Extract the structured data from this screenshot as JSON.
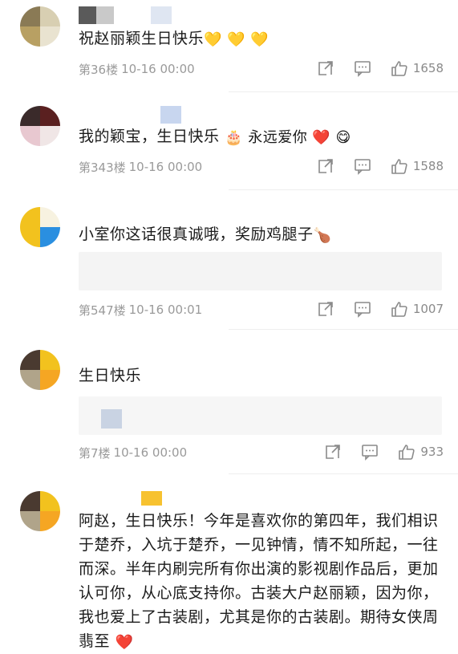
{
  "comments": [
    {
      "text": "祝赵丽颖生日快乐",
      "emoji": "💛 💛 💛",
      "floor": "第36楼",
      "time": "10-16 00:00",
      "likes": "1658"
    },
    {
      "text": "我的颖宝，生日快乐",
      "emoji": "🎂 永远爱你 ❤️ 😋",
      "floor": "第343楼",
      "time": "10-16 00:00",
      "likes": "1588"
    },
    {
      "text": "小室你这话很真诚哦，奖励鸡腿子",
      "emoji": "🍗",
      "floor": "第547楼",
      "time": "10-16 00:01",
      "likes": "1007"
    },
    {
      "text": "生日快乐",
      "emoji": "",
      "floor": "第7楼",
      "time": "10-16 00:00",
      "likes": "933"
    },
    {
      "text": "阿赵，生日快乐！今年是喜欢你的第四年，我们相识于楚乔，入坑于楚乔，一见钟情，情不知所起，一往而深。半年内刷完所有你出演的影视剧作品后，更加认可你，从心底支持你。古装大户赵丽颖，因为你，我也爱上了古装剧，尤其是你的古装剧。期待女侠周翡至",
      "emoji": "❤️",
      "floor": "",
      "time": "",
      "likes": ""
    }
  ],
  "icons": {
    "share": "share-icon",
    "reply": "comment-icon",
    "like": "thumbs-up-icon"
  },
  "colors": {
    "meta": "#9a9a9a",
    "text": "#1a1a1a",
    "heart": "#e0282e",
    "gold": "#f5c518"
  }
}
